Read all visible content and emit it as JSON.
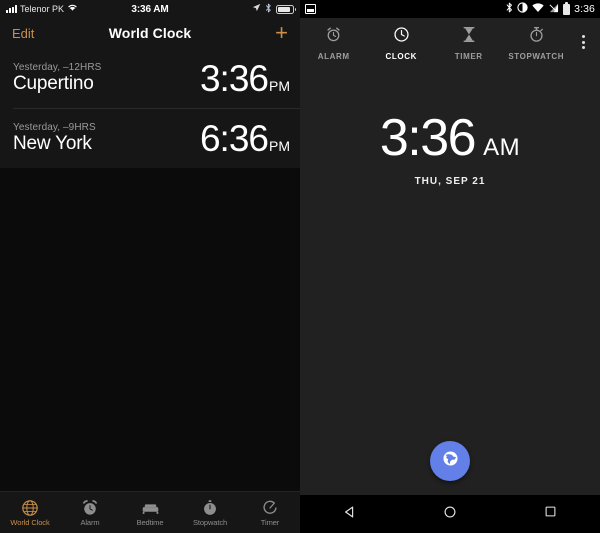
{
  "ios": {
    "status_bar": {
      "carrier": "Telenor PK",
      "time": "3:36 AM",
      "icons": [
        "signal-bars-icon",
        "wifi-icon",
        "location-arrow-icon",
        "bluetooth-icon",
        "battery-icon"
      ]
    },
    "nav_bar": {
      "edit_label": "Edit",
      "title": "World Clock",
      "add_label": "+"
    },
    "accent_color": "#c98f4b",
    "clocks": [
      {
        "subtitle": "Yesterday, –12HRS",
        "city": "Cupertino",
        "time": "3:36",
        "meridiem": "PM"
      },
      {
        "subtitle": "Yesterday, –9HRS",
        "city": "New York",
        "time": "6:36",
        "meridiem": "PM"
      }
    ],
    "tabs": [
      {
        "label": "World Clock",
        "icon": "globe-icon",
        "active": true
      },
      {
        "label": "Alarm",
        "icon": "alarm-clock-icon",
        "active": false
      },
      {
        "label": "Bedtime",
        "icon": "bed-icon",
        "active": false
      },
      {
        "label": "Stopwatch",
        "icon": "stopwatch-icon",
        "active": false
      },
      {
        "label": "Timer",
        "icon": "timer-icon",
        "active": false
      }
    ]
  },
  "android": {
    "status_bar": {
      "time": "3:36",
      "icons": [
        "screenshot-icon",
        "bluetooth-icon",
        "vibrate-icon",
        "wifi-icon",
        "cell-signal-icon",
        "battery-icon"
      ]
    },
    "tabs": [
      {
        "label": "ALARM",
        "icon": "alarm-clock-icon",
        "active": false
      },
      {
        "label": "CLOCK",
        "icon": "clock-icon",
        "active": true
      },
      {
        "label": "TIMER",
        "icon": "hourglass-icon",
        "active": false
      },
      {
        "label": "STOPWATCH",
        "icon": "stopwatch-icon",
        "active": false
      }
    ],
    "overflow_icon": "more-vertical-icon",
    "clock": {
      "time": "3:36",
      "meridiem": "AM",
      "date": "THU, SEP 21"
    },
    "fab": {
      "icon": "globe-icon",
      "color": "#637fe8"
    },
    "nav_buttons": [
      {
        "name": "back-button",
        "icon": "triangle-back-icon"
      },
      {
        "name": "home-button",
        "icon": "circle-home-icon"
      },
      {
        "name": "recents-button",
        "icon": "square-recents-icon"
      }
    ]
  }
}
